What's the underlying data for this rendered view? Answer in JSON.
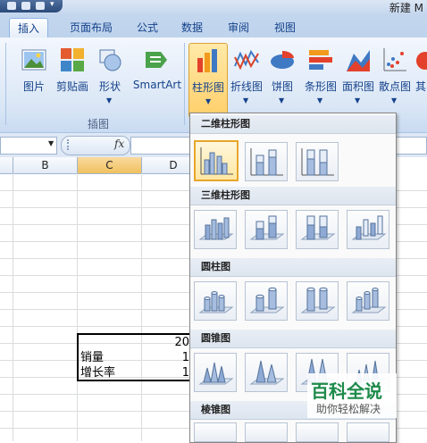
{
  "titlebar": {
    "title": "新建 M"
  },
  "tabs": [
    {
      "label": "插入",
      "active": true
    },
    {
      "label": "页面布局"
    },
    {
      "label": "公式"
    },
    {
      "label": "数据"
    },
    {
      "label": "审阅"
    },
    {
      "label": "视图"
    }
  ],
  "ribbon": {
    "buttons": {
      "picture": "图片",
      "clipart": "剪贴画",
      "shapes": "形状",
      "smartart": "SmartArt",
      "bar": "柱形图",
      "line": "折线图",
      "pie": "饼图",
      "hbar": "条形图",
      "area": "面积图",
      "scatter": "散点图",
      "other": "其"
    },
    "group_illustrations": "插图"
  },
  "formula": {
    "fx": "fx"
  },
  "columns": [
    "B",
    "C",
    "D"
  ],
  "cells": {
    "d_header": "20",
    "label_sales": "销量",
    "label_growth": "增长率",
    "d_sales": "1",
    "d_growth": "1"
  },
  "dropdown": {
    "sections": [
      "二维柱形图",
      "三维柱形图",
      "圆柱图",
      "圆锥图",
      "棱锥图"
    ]
  },
  "watermark": {
    "line1": "百科全说",
    "line2": "助你轻松解决"
  },
  "colors": {
    "accent": "#15428b",
    "highlight": "#ffcf6a",
    "ribbon": "#dbe7f6"
  }
}
